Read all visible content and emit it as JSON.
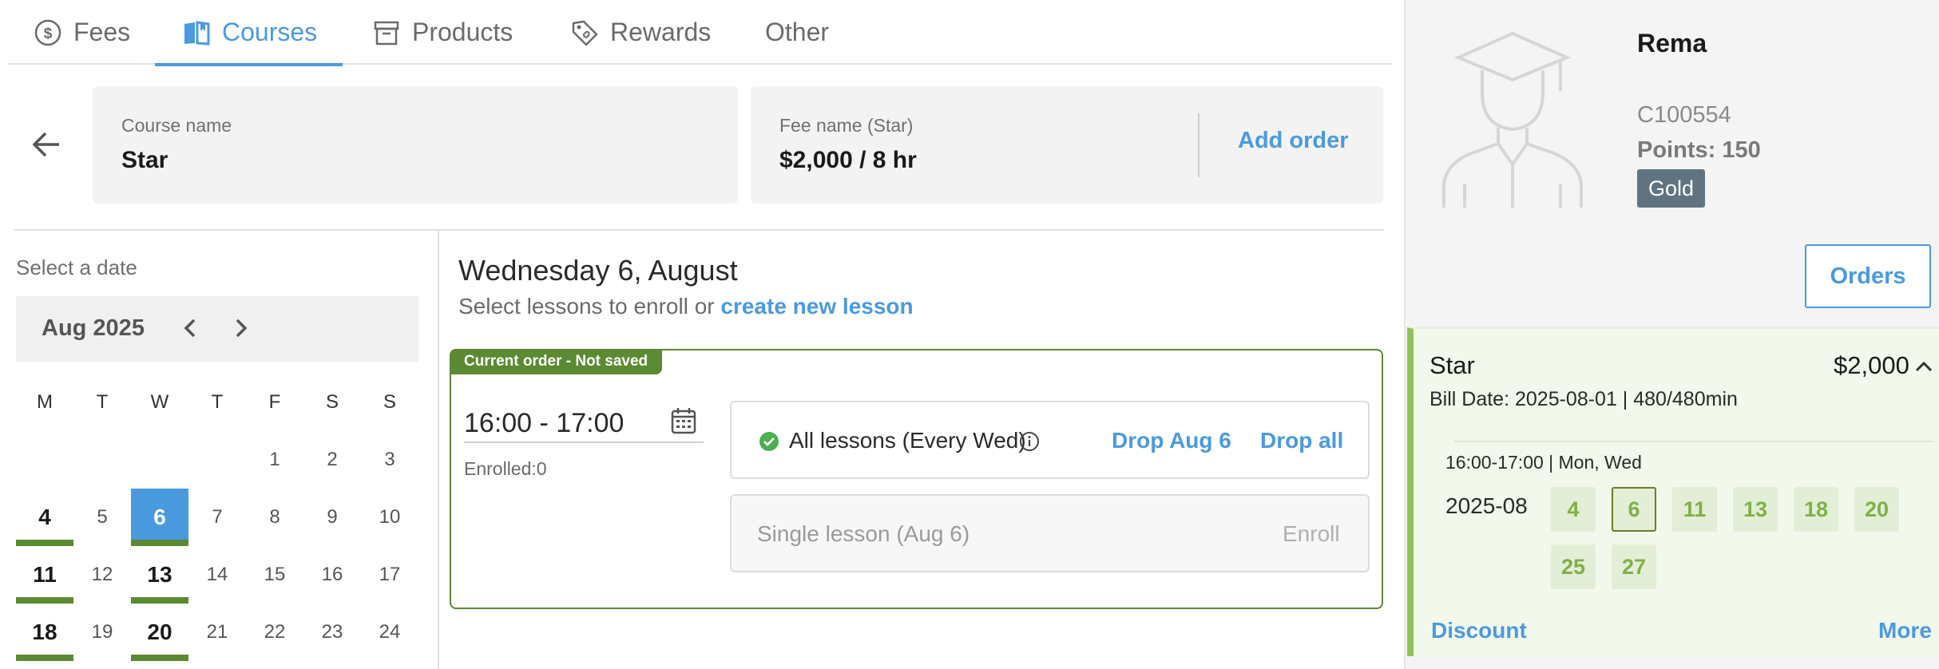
{
  "tabs": [
    {
      "label": "Fees",
      "icon": "dollar-circle-icon"
    },
    {
      "label": "Courses",
      "icon": "book-icon",
      "active": true
    },
    {
      "label": "Products",
      "icon": "archive-box-icon"
    },
    {
      "label": "Rewards",
      "icon": "tag-icon"
    },
    {
      "label": "Other"
    }
  ],
  "course": {
    "label": "Course name",
    "value": "Star"
  },
  "fee": {
    "label": "Fee name (Star)",
    "value": "$2,000 / 8 hr",
    "add_order": "Add order"
  },
  "calendar": {
    "prompt": "Select a date",
    "month": "Aug 2025",
    "weekdays": [
      "M",
      "T",
      "W",
      "T",
      "F",
      "S",
      "S"
    ],
    "row1": [
      "1",
      "2",
      "3"
    ],
    "row2": [
      "4",
      "5",
      "6",
      "7",
      "8",
      "9",
      "10"
    ],
    "row3": [
      "11",
      "12",
      "13",
      "14",
      "15",
      "16",
      "17"
    ],
    "row4": [
      "18",
      "19",
      "20",
      "21",
      "22",
      "23",
      "24"
    ]
  },
  "lessons": {
    "date_title": "Wednesday 6, August",
    "subtitle_prefix": "Select lessons to enroll or ",
    "subtitle_link": "create new lesson",
    "order_tag": "Current order - Not saved",
    "time": "16:00 - 17:00",
    "enrolled": "Enrolled:0",
    "all_lessons": "All lessons (Every Wed)",
    "drop_day": "Drop Aug 6",
    "drop_all": "Drop all",
    "single_lesson": "Single lesson (Aug 6)",
    "enroll": "Enroll"
  },
  "customer": {
    "name": "Rema",
    "id": "C100554",
    "points": "Points: 150",
    "tier": "Gold",
    "orders_button": "Orders"
  },
  "order": {
    "name": "Star",
    "price": "$2,000",
    "bill": "Bill Date: 2025-08-01 | 480/480min",
    "schedule": "16:00-17:00 | Mon, Wed",
    "month": "2025-08",
    "dates": [
      "4",
      "6",
      "11",
      "13",
      "18",
      "20",
      "25",
      "27"
    ],
    "discount": "Discount",
    "more": "More"
  },
  "colors": {
    "accent": "#4a9ae0",
    "green": "#5a8a32",
    "light_green": "#8cc35a",
    "badge": "#5f7480"
  }
}
